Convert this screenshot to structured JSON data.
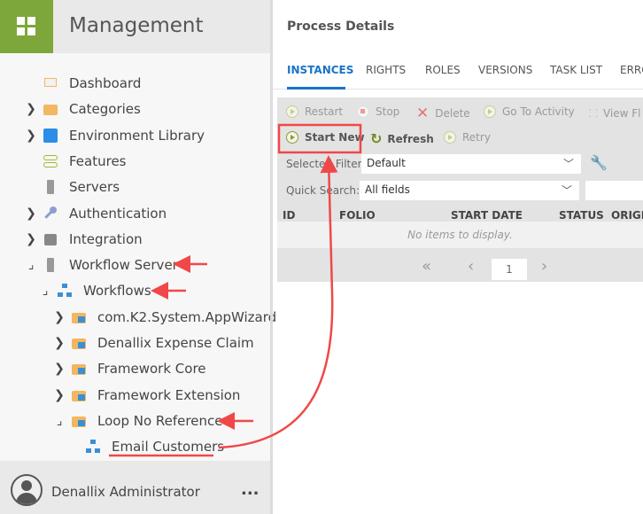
{
  "app": {
    "title": "Management",
    "accent": "#7da73a"
  },
  "tree": [
    {
      "label": "Dashboard",
      "icon": "easel-icon",
      "expander": "none"
    },
    {
      "label": "Categories",
      "icon": "folder-icon",
      "expander": "collapsed"
    },
    {
      "label": "Environment Library",
      "icon": "library-icon",
      "expander": "collapsed"
    },
    {
      "label": "Features",
      "icon": "toggle-icon",
      "expander": "none"
    },
    {
      "label": "Servers",
      "icon": "server-icon",
      "expander": "none"
    },
    {
      "label": "Authentication",
      "icon": "key-icon",
      "expander": "collapsed"
    },
    {
      "label": "Integration",
      "icon": "puzzle-icon",
      "expander": "collapsed"
    },
    {
      "label": "Workflow Server",
      "icon": "server-icon",
      "expander": "expanded"
    },
    {
      "label": "Workflows",
      "icon": "workflow-icon",
      "expander": "expanded"
    },
    {
      "label": "com.K2.System.AppWizard",
      "icon": "workflow-folder-icon",
      "expander": "collapsed"
    },
    {
      "label": "Denallix Expense Claim",
      "icon": "workflow-folder-icon",
      "expander": "collapsed"
    },
    {
      "label": "Framework Core",
      "icon": "workflow-folder-icon",
      "expander": "collapsed"
    },
    {
      "label": "Framework Extension",
      "icon": "workflow-folder-icon",
      "expander": "collapsed"
    },
    {
      "label": "Loop No Reference",
      "icon": "workflow-folder-icon",
      "expander": "expanded"
    },
    {
      "label": "Email Customers",
      "icon": "workflow-icon",
      "expander": "none"
    }
  ],
  "footer": {
    "user": "Denallix Administrator",
    "more": "..."
  },
  "main": {
    "title": "Process Details",
    "tabs": [
      "INSTANCES",
      "RIGHTS",
      "ROLES",
      "VERSIONS",
      "TASK LIST",
      "ERRO"
    ],
    "toolbar": {
      "restart": "Restart",
      "stop": "Stop",
      "delete": "Delete",
      "goto": "Go To Activity",
      "viewflow": "View Fl",
      "start_new": "Start New",
      "refresh": "Refresh",
      "retry": "Retry"
    },
    "filter": {
      "label": "Selected Filter:",
      "value": "Default"
    },
    "search": {
      "label": "Quick Search:",
      "value": "All fields"
    },
    "columns": [
      "ID",
      "FOLIO",
      "START DATE",
      "STATUS",
      "ORIGI"
    ],
    "empty": "No items to display.",
    "page": "1"
  }
}
